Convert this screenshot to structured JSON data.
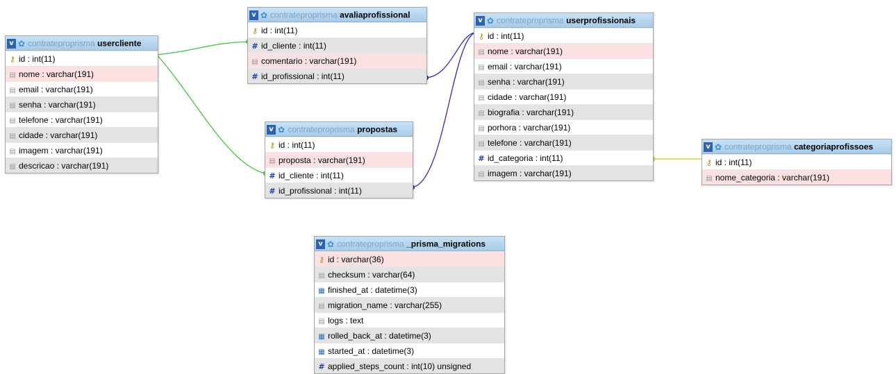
{
  "database": "contrateproprisma",
  "tables": [
    {
      "id": "usercliente",
      "name": "usercliente",
      "columns": [
        {
          "text": "id : int(11)",
          "icon": "key",
          "bg": "w"
        },
        {
          "text": "nome : varchar(191)",
          "icon": "field",
          "bg": "p"
        },
        {
          "text": "email : varchar(191)",
          "icon": "field",
          "bg": "w"
        },
        {
          "text": "senha : varchar(191)",
          "icon": "field",
          "bg": "g"
        },
        {
          "text": "telefone : varchar(191)",
          "icon": "field",
          "bg": "w"
        },
        {
          "text": "cidade : varchar(191)",
          "icon": "field",
          "bg": "g"
        },
        {
          "text": "imagem : varchar(191)",
          "icon": "field",
          "bg": "w"
        },
        {
          "text": "descricao : varchar(191)",
          "icon": "field",
          "bg": "g"
        }
      ]
    },
    {
      "id": "avaliaprofissional",
      "name": "avaliaprofissional",
      "columns": [
        {
          "text": "id : int(11)",
          "icon": "key",
          "bg": "w"
        },
        {
          "text": "id_cliente : int(11)",
          "icon": "hash",
          "bg": "g"
        },
        {
          "text": "comentario : varchar(191)",
          "icon": "field",
          "bg": "p"
        },
        {
          "text": "id_profissional : int(11)",
          "icon": "hash",
          "bg": "g"
        }
      ]
    },
    {
      "id": "propostas",
      "name": "propostas",
      "columns": [
        {
          "text": "id : int(11)",
          "icon": "key",
          "bg": "w"
        },
        {
          "text": "proposta : varchar(191)",
          "icon": "field",
          "bg": "p"
        },
        {
          "text": "id_cliente : int(11)",
          "icon": "hash",
          "bg": "w"
        },
        {
          "text": "id_profissional : int(11)",
          "icon": "hash",
          "bg": "g"
        }
      ]
    },
    {
      "id": "userprofissionais",
      "name": "userprofissionais",
      "columns": [
        {
          "text": "id : int(11)",
          "icon": "key",
          "bg": "w"
        },
        {
          "text": "nome : varchar(191)",
          "icon": "field",
          "bg": "p"
        },
        {
          "text": "email : varchar(191)",
          "icon": "field",
          "bg": "w"
        },
        {
          "text": "senha : varchar(191)",
          "icon": "field",
          "bg": "g"
        },
        {
          "text": "cidade : varchar(191)",
          "icon": "field",
          "bg": "w"
        },
        {
          "text": "biografia : varchar(191)",
          "icon": "field",
          "bg": "g"
        },
        {
          "text": "porhora : varchar(191)",
          "icon": "field",
          "bg": "w"
        },
        {
          "text": "telefone : varchar(191)",
          "icon": "field",
          "bg": "g"
        },
        {
          "text": "id_categoria : int(11)",
          "icon": "hash",
          "bg": "w"
        },
        {
          "text": "imagem : varchar(191)",
          "icon": "field",
          "bg": "g"
        }
      ]
    },
    {
      "id": "categoriaprofissoes",
      "name": "categoriaprofissoes",
      "columns": [
        {
          "text": "id : int(11)",
          "icon": "key",
          "bg": "w"
        },
        {
          "text": "nome_categoria : varchar(191)",
          "icon": "field",
          "bg": "p"
        }
      ]
    },
    {
      "id": "prisma-migrations",
      "name": "_prisma_migrations",
      "columns": [
        {
          "text": "id : varchar(36)",
          "icon": "key",
          "bg": "p"
        },
        {
          "text": "checksum : varchar(64)",
          "icon": "field",
          "bg": "g"
        },
        {
          "text": "finished_at : datetime(3)",
          "icon": "date",
          "bg": "w"
        },
        {
          "text": "migration_name : varchar(255)",
          "icon": "field",
          "bg": "g"
        },
        {
          "text": "logs : text",
          "icon": "field",
          "bg": "w"
        },
        {
          "text": "rolled_back_at : datetime(3)",
          "icon": "date",
          "bg": "g"
        },
        {
          "text": "started_at : datetime(3)",
          "icon": "date",
          "bg": "w"
        },
        {
          "text": "applied_steps_count : int(10) unsigned",
          "icon": "hash",
          "bg": "g"
        }
      ]
    }
  ],
  "relations": [
    {
      "from": "avaliaprofissional.id_cliente",
      "to": "usercliente.id",
      "color": "#3cc63c"
    },
    {
      "from": "propostas.id_cliente",
      "to": "usercliente.id",
      "color": "#3cc63c"
    },
    {
      "from": "avaliaprofissional.id_profissional",
      "to": "userprofissionais.id",
      "color": "#2b2bb5"
    },
    {
      "from": "propostas.id_profissional",
      "to": "userprofissionais.id",
      "color": "#2b2bb5"
    },
    {
      "from": "userprofissionais.id_categoria",
      "to": "categoriaprofissoes.id",
      "color": "#cccc22"
    }
  ],
  "icons": {
    "toggle": "toggle-v-icon",
    "gear": "gear-icon",
    "key": "primary-key-icon",
    "hash": "index-hash-icon",
    "field": "field-icon",
    "date": "datetime-icon"
  }
}
